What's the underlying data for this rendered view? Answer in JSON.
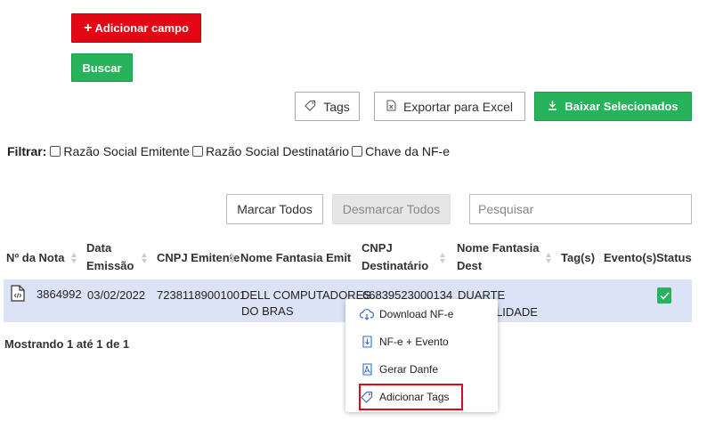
{
  "toolbar": {
    "add_field_label": "Adicionar campo",
    "search_button_label": "Buscar",
    "tags_label": "Tags",
    "export_label": "Exportar para Excel",
    "download_selected_label": "Baixar Selecionados"
  },
  "filter": {
    "label": "Filtrar:",
    "options": [
      {
        "label": "Razão Social Emitente",
        "checked": false
      },
      {
        "label": "Razão Social Destinatário",
        "checked": false
      },
      {
        "label": "Chave da NF-e",
        "checked": false
      }
    ]
  },
  "table_controls": {
    "select_all_label": "Marcar Todos",
    "deselect_all_label": "Desmarcar Todos",
    "search_placeholder": "Pesquisar"
  },
  "table": {
    "headers": {
      "numero": "Nº da Nota",
      "data_line1": "Data",
      "data_line2": "Emissão",
      "cnpj_emit": "CNPJ Emitente",
      "nome_emit": "Nome Fantasia Emit",
      "cnpj_dest_line1": "CNPJ",
      "cnpj_dest_line2": "Destinatário",
      "nome_dest_line1": "Nome Fantasia",
      "nome_dest_line2": "Dest",
      "tags": "Tag(s)",
      "eventos": "Evento(s)",
      "status": "Status"
    },
    "rows": [
      {
        "numero": "3864992",
        "data": "03/02/2022",
        "cnpj_emit": "72381189001001",
        "nome_emit_line1": "DELL COMPUTADORES",
        "nome_emit_line2": "DO BRAS",
        "cnpj_dest": "66839523000134",
        "nome_dest_line1": "DUARTE",
        "nome_dest_line2": "LIDADE",
        "status": "ok"
      }
    ]
  },
  "pagination": {
    "info": "Mostrando 1 até 1 de 1"
  },
  "context_menu": {
    "items": [
      {
        "label": "Download NF-e",
        "icon": "cloud-download-icon"
      },
      {
        "label": "NF-e + Evento",
        "icon": "document-download-icon"
      },
      {
        "label": "Gerar Danfe",
        "icon": "pdf-icon"
      },
      {
        "label": "Adicionar Tags",
        "icon": "tag-icon"
      }
    ]
  },
  "colors": {
    "red": "#e30613",
    "green": "#27b35b",
    "row_highlight": "#dde3f6"
  }
}
